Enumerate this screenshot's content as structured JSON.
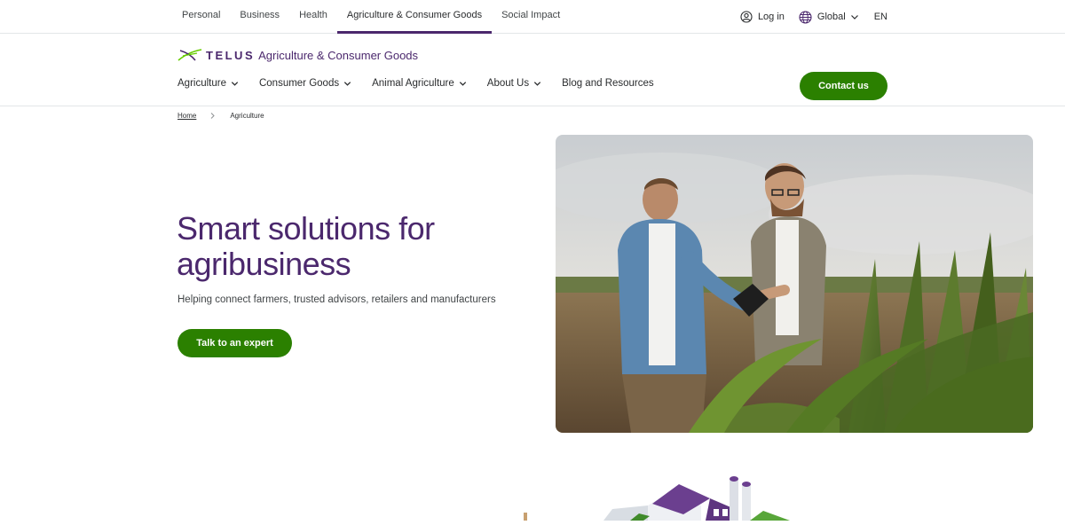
{
  "topbar": {
    "segments": [
      {
        "label": "Personal",
        "active": false
      },
      {
        "label": "Business",
        "active": false
      },
      {
        "label": "Health",
        "active": false
      },
      {
        "label": "Agriculture & Consumer Goods",
        "active": true
      },
      {
        "label": "Social Impact",
        "active": false
      }
    ],
    "login_label": "Log in",
    "region_label": "Global",
    "language_label": "EN"
  },
  "header": {
    "brand": "TELUS",
    "brand_sub": "Agriculture & Consumer Goods",
    "nav": [
      {
        "label": "Agriculture",
        "has_dropdown": true
      },
      {
        "label": "Consumer Goods",
        "has_dropdown": true
      },
      {
        "label": "Animal Agriculture",
        "has_dropdown": true
      },
      {
        "label": "About Us",
        "has_dropdown": true
      },
      {
        "label": "Blog and Resources",
        "has_dropdown": false
      }
    ],
    "contact_label": "Contact us"
  },
  "breadcrumb": {
    "home": "Home",
    "current": "Agriculture"
  },
  "hero": {
    "title": "Smart solutions for agribusiness",
    "subtitle": "Helping connect farmers, trusted advisors, retailers and manufacturers",
    "cta_label": "Talk to an expert"
  },
  "colors": {
    "brand_purple": "#4b286d",
    "cta_green": "#2b8000",
    "logo_green": "#66cc00"
  },
  "icons": [
    "user-icon",
    "globe-icon",
    "chevron-down-icon",
    "chevron-right-icon",
    "telus-logo-icon"
  ]
}
